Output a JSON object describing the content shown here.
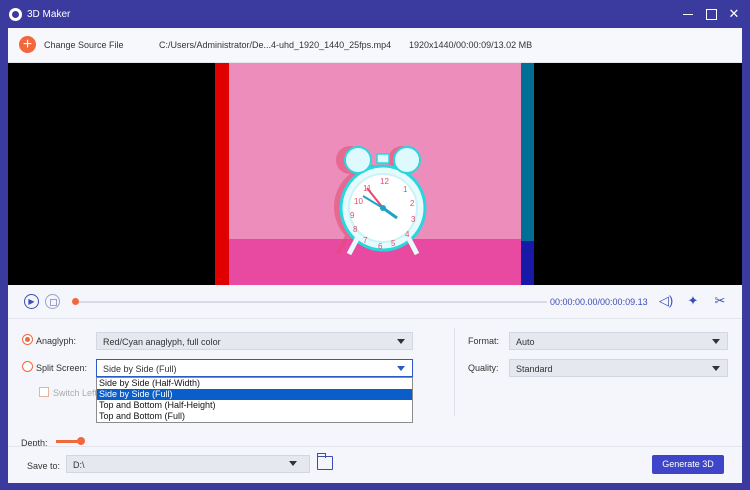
{
  "window": {
    "title": "3D Maker",
    "close_glyph": "✕"
  },
  "toolbar": {
    "change_source": "Change Source File",
    "file_path": "C:/Users/Administrator/De...4-uhd_1920_1440_25fps.mp4",
    "file_meta": "1920x1440/00:00:09/13.02 MB"
  },
  "playback": {
    "timecode": "00:00:00.00/00:00:09.13",
    "progress": 0.0
  },
  "options": {
    "anaglyph_label": "Anaglyph:",
    "anaglyph_value": "Red/Cyan anaglyph, full color",
    "split_label": "Split Screen:",
    "split_value": "Side by Side (Full)",
    "switch_label": "Switch Left",
    "depth_label": "Depth:",
    "format_label": "Format:",
    "format_value": "Auto",
    "quality_label": "Quality:",
    "quality_value": "Standard",
    "split_options": [
      "Side by Side (Half-Width)",
      "Side by Side (Full)",
      "Top and Bottom (Half-Height)",
      "Top and Bottom (Full)"
    ]
  },
  "footer": {
    "save_label": "Save to:",
    "save_path": "D:\\",
    "generate_label": "Generate 3D"
  },
  "colors": {
    "accent": "#3e45c8",
    "orange": "#f2683d",
    "titlebar": "#3b3a9e"
  },
  "icons": [
    "app-logo-icon",
    "minimize-icon",
    "maximize-icon",
    "close-icon",
    "add-icon",
    "play-icon",
    "stop-icon",
    "volume-icon",
    "magic-icon",
    "cut-icon",
    "folder-icon"
  ]
}
